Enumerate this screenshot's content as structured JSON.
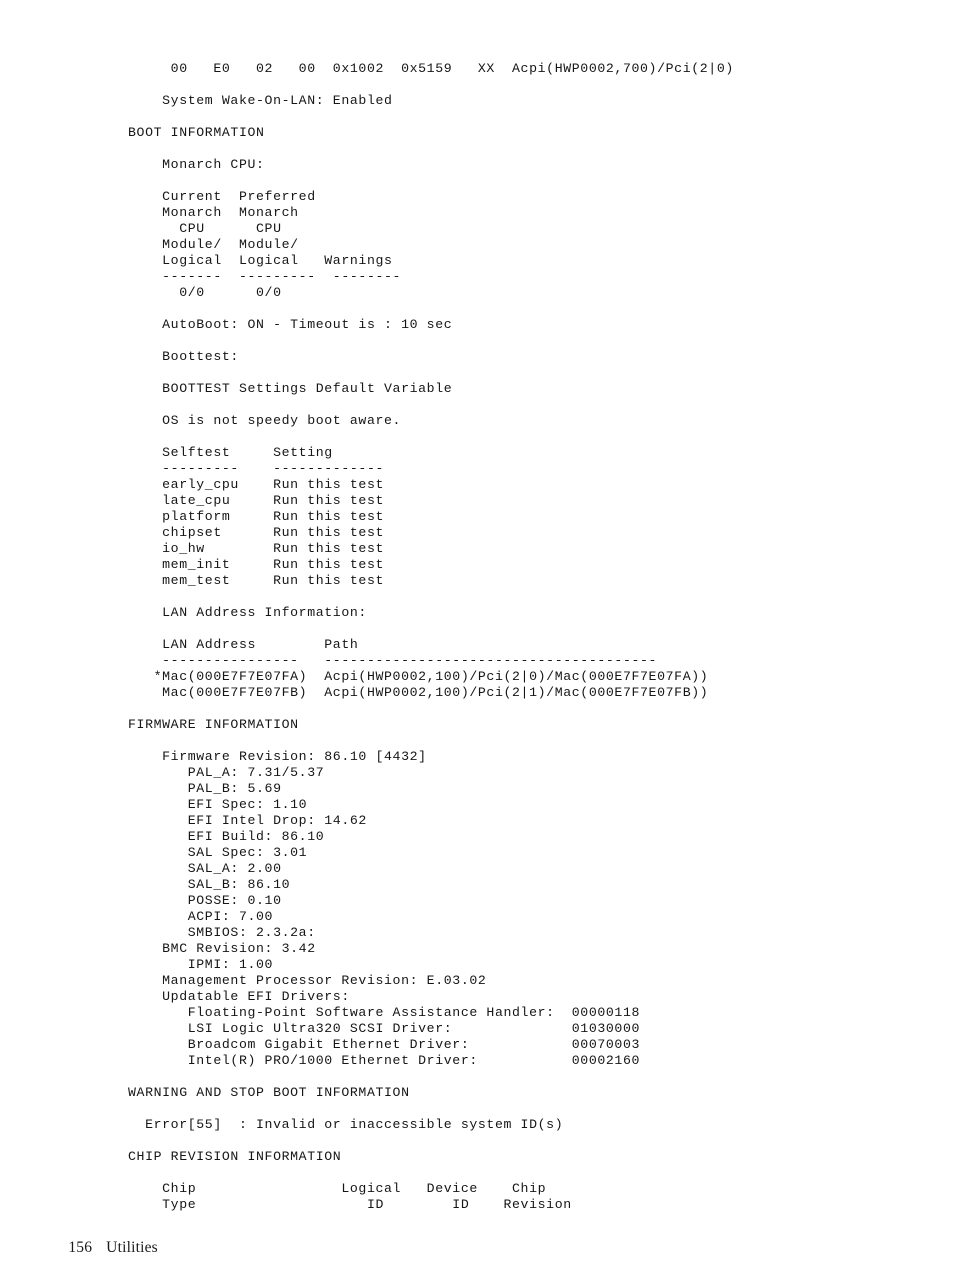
{
  "page": {
    "footer": {
      "page_number": "156",
      "section_title": "Utilities"
    }
  },
  "console": {
    "lines": [
      "     00   E0   02   00  0x1002  0x5159   XX  Acpi(HWP0002,700)/Pci(2|0)",
      "",
      "    System Wake-On-LAN: Enabled",
      "",
      "BOOT INFORMATION",
      "",
      "    Monarch CPU:",
      "",
      "    Current  Preferred",
      "    Monarch  Monarch",
      "      CPU      CPU",
      "    Module/  Module/",
      "    Logical  Logical   Warnings",
      "    -------  ---------  --------",
      "      0/0      0/0",
      "",
      "    AutoBoot: ON - Timeout is : 10 sec",
      "",
      "    Boottest:",
      "",
      "    BOOTTEST Settings Default Variable",
      "",
      "    OS is not speedy boot aware.",
      "",
      "    Selftest     Setting",
      "    ---------    -------------",
      "    early_cpu    Run this test",
      "    late_cpu     Run this test",
      "    platform     Run this test",
      "    chipset      Run this test",
      "    io_hw        Run this test",
      "    mem_init     Run this test",
      "    mem_test     Run this test",
      "",
      "    LAN Address Information:",
      "",
      "    LAN Address        Path",
      "    ----------------   ---------------------------------------",
      "   *Mac(000E7F7E07FA)  Acpi(HWP0002,100)/Pci(2|0)/Mac(000E7F7E07FA))",
      "    Mac(000E7F7E07FB)  Acpi(HWP0002,100)/Pci(2|1)/Mac(000E7F7E07FB))",
      "",
      "FIRMWARE INFORMATION",
      "",
      "    Firmware Revision: 86.10 [4432]",
      "       PAL_A: 7.31/5.37",
      "       PAL_B: 5.69",
      "       EFI Spec: 1.10",
      "       EFI Intel Drop: 14.62",
      "       EFI Build: 86.10",
      "       SAL Spec: 3.01",
      "       SAL_A: 2.00",
      "       SAL_B: 86.10",
      "       POSSE: 0.10",
      "       ACPI: 7.00",
      "       SMBIOS: 2.3.2a:",
      "    BMC Revision: 3.42",
      "       IPMI: 1.00",
      "    Management Processor Revision: E.03.02",
      "    Updatable EFI Drivers:",
      "       Floating-Point Software Assistance Handler:  00000118",
      "       LSI Logic Ultra320 SCSI Driver:              01030000",
      "       Broadcom Gigabit Ethernet Driver:            00070003",
      "       Intel(R) PRO/1000 Ethernet Driver:           00002160",
      "",
      "WARNING AND STOP BOOT INFORMATION",
      "",
      "  Error[55]  : Invalid or inaccessible system ID(s)",
      "",
      "CHIP REVISION INFORMATION",
      "",
      "    Chip                 Logical   Device    Chip",
      "    Type                    ID        ID    Revision"
    ],
    "sections": {
      "boot_information": {
        "heading": "BOOT INFORMATION",
        "monarch_cpu_label": "Monarch CPU:",
        "monarch_table": {
          "headers": [
            "Current\nMonarch\n  CPU\nModule/\nLogical",
            "Preferred\nMonarch\n  CPU\nModule/\nLogical",
            "Warnings"
          ],
          "rules": [
            "-------",
            "---------",
            "--------"
          ],
          "rows": [
            [
              "0/0",
              "0/0",
              ""
            ]
          ]
        },
        "autoboot": "AutoBoot: ON - Timeout is : 10 sec",
        "boottest_label": "Boottest:",
        "boottest_settings": "BOOTTEST Settings Default Variable",
        "speedy_boot_note": "OS is not speedy boot aware.",
        "selftest_table": {
          "headers": [
            "Selftest",
            "Setting"
          ],
          "rules": [
            "---------",
            "-------------"
          ],
          "rows": [
            [
              "early_cpu",
              "Run this test"
            ],
            [
              "late_cpu",
              "Run this test"
            ],
            [
              "platform",
              "Run this test"
            ],
            [
              "chipset",
              "Run this test"
            ],
            [
              "io_hw",
              "Run this test"
            ],
            [
              "mem_init",
              "Run this test"
            ],
            [
              "mem_test",
              "Run this test"
            ]
          ]
        },
        "lan_label": "LAN Address Information:",
        "lan_table": {
          "headers": [
            "LAN Address",
            "Path"
          ],
          "rules": [
            "----------------",
            "---------------------------------------"
          ],
          "rows": [
            [
              "*Mac(000E7F7E07FA)",
              "Acpi(HWP0002,100)/Pci(2|0)/Mac(000E7F7E07FA))"
            ],
            [
              "Mac(000E7F7E07FB)",
              "Acpi(HWP0002,100)/Pci(2|1)/Mac(000E7F7E07FB))"
            ]
          ]
        }
      },
      "device_row": {
        "columns": [
          "00",
          "E0",
          "02",
          "00",
          "0x1002",
          "0x5159",
          "XX",
          "Acpi(HWP0002,700)/Pci(2|0)"
        ]
      },
      "wake_on_lan": "System Wake-On-LAN: Enabled",
      "firmware_information": {
        "heading": "FIRMWARE INFORMATION",
        "firmware_revision": "Firmware Revision: 86.10 [4432]",
        "items": [
          {
            "label": "PAL_A:",
            "value": "7.31/5.37"
          },
          {
            "label": "PAL_B:",
            "value": "5.69"
          },
          {
            "label": "EFI Spec:",
            "value": "1.10"
          },
          {
            "label": "EFI Intel Drop:",
            "value": "14.62"
          },
          {
            "label": "EFI Build:",
            "value": "86.10"
          },
          {
            "label": "SAL Spec:",
            "value": "3.01"
          },
          {
            "label": "SAL_A:",
            "value": "2.00"
          },
          {
            "label": "SAL_B:",
            "value": "86.10"
          },
          {
            "label": "POSSE:",
            "value": "0.10"
          },
          {
            "label": "ACPI:",
            "value": "7.00"
          },
          {
            "label": "SMBIOS:",
            "value": "2.3.2a:"
          }
        ],
        "bmc_revision": "BMC Revision: 3.42",
        "ipmi": "IPMI: 1.00",
        "management_processor_revision": "Management Processor Revision: E.03.02",
        "updatable_efi_drivers_label": "Updatable EFI Drivers:",
        "updatable_efi_drivers": [
          {
            "name": "Floating-Point Software Assistance Handler:",
            "version": "00000118"
          },
          {
            "name": "LSI Logic Ultra320 SCSI Driver:",
            "version": "01030000"
          },
          {
            "name": "Broadcom Gigabit Ethernet Driver:",
            "version": "00070003"
          },
          {
            "name": "Intel(R) PRO/1000 Ethernet Driver:",
            "version": "00002160"
          }
        ]
      },
      "warning_stop_boot": {
        "heading": "WARNING AND STOP BOOT INFORMATION",
        "error": "Error[55]  : Invalid or inaccessible system ID(s)"
      },
      "chip_revision": {
        "heading": "CHIP REVISION INFORMATION",
        "headers_line1": [
          "Chip",
          "Logical",
          "Device",
          "Chip"
        ],
        "headers_line2": [
          "Type",
          "ID",
          "ID",
          "Revision"
        ]
      }
    }
  }
}
